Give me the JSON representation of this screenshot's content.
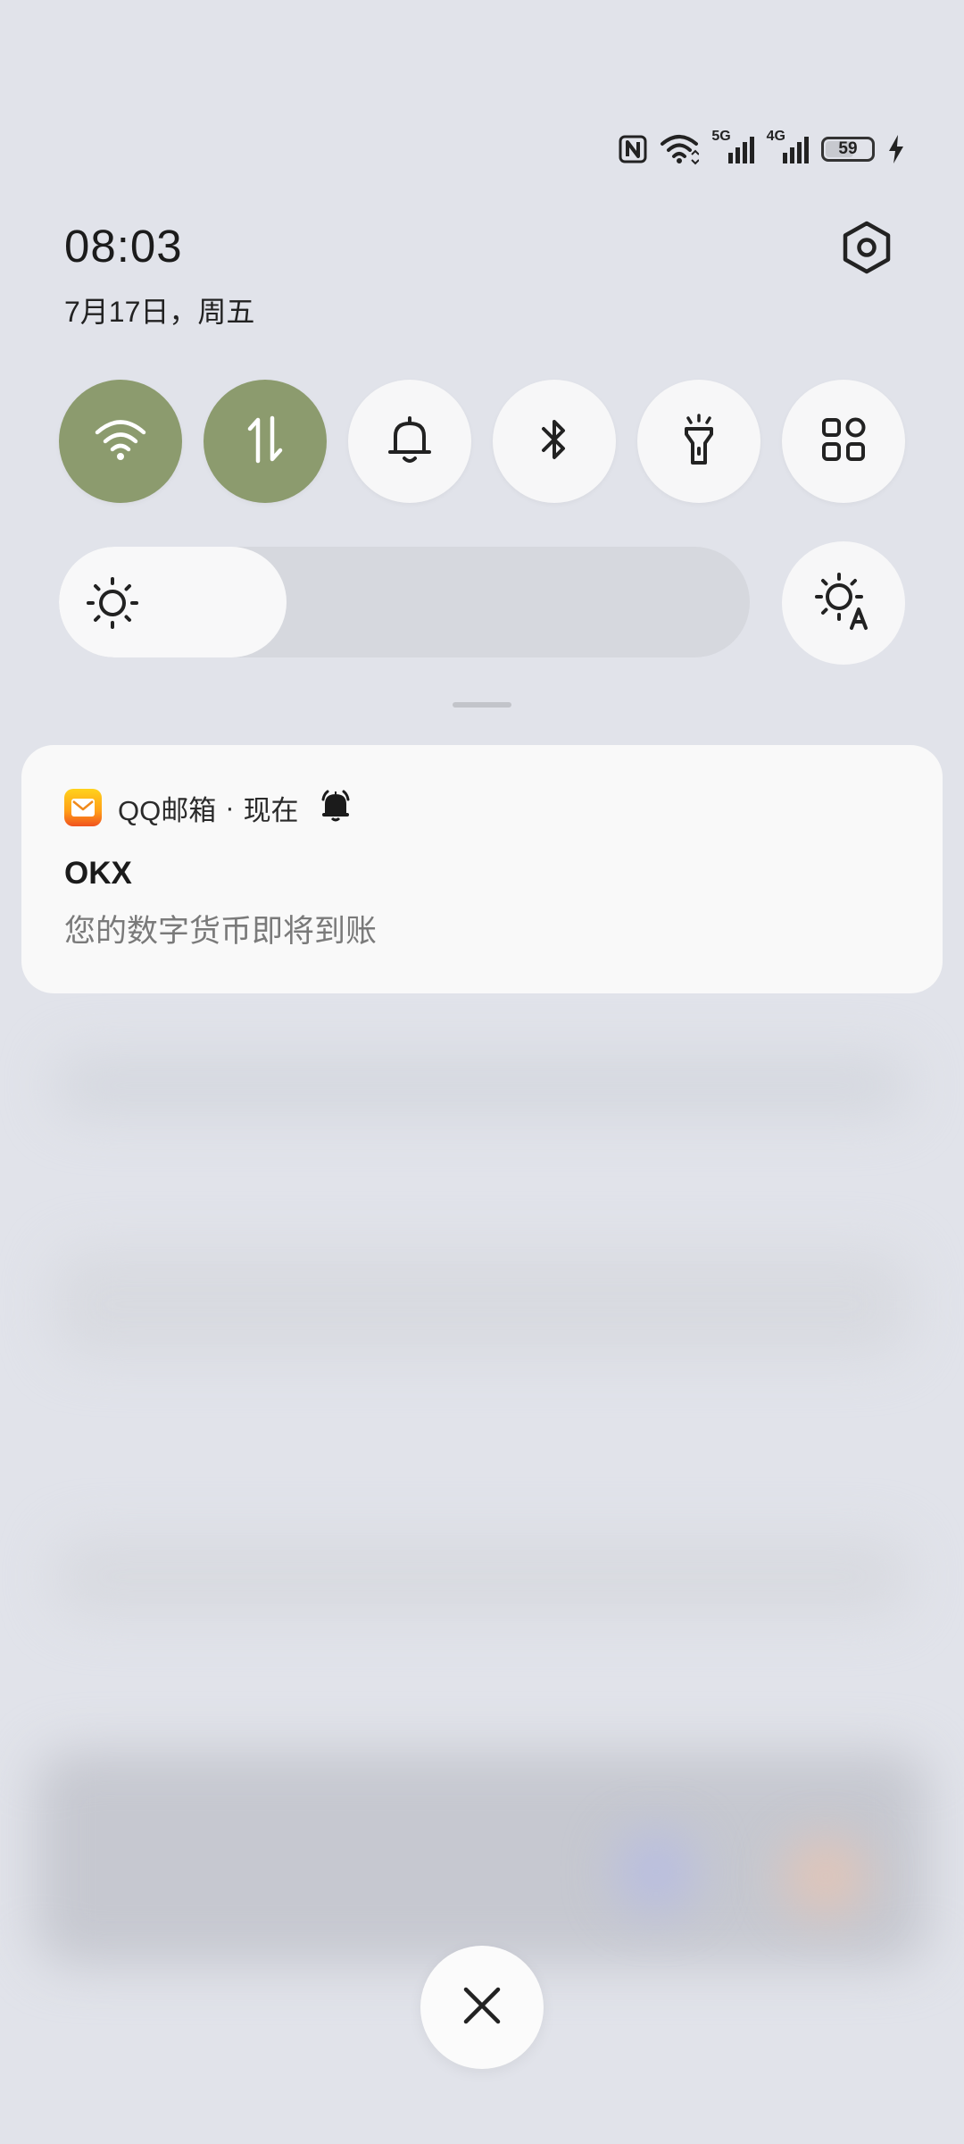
{
  "status_bar": {
    "net_5g": "5G",
    "net_4g": "4G",
    "battery_level": "59",
    "icons": [
      "nfc-icon",
      "wifi-icon",
      "signal-5g-icon",
      "signal-4g-icon",
      "battery-icon",
      "charging-icon"
    ]
  },
  "header": {
    "time": "08:03",
    "date": "7月17日，周五"
  },
  "quick_tiles": [
    {
      "name": "wifi",
      "active": true
    },
    {
      "name": "mobile-data",
      "active": true
    },
    {
      "name": "ring-mode",
      "active": false
    },
    {
      "name": "bluetooth",
      "active": false
    },
    {
      "name": "flashlight",
      "active": false
    },
    {
      "name": "more-tiles",
      "active": false
    }
  ],
  "brightness": {
    "level": 0.33
  },
  "notification": {
    "app_name": "QQ邮箱",
    "separator": "·",
    "time": "现在",
    "title": "OKX",
    "body": "您的数字货币即将到账"
  },
  "colors": {
    "active_tile": "#8c9b6e",
    "app_icon_top": "#ffd21c",
    "app_icon_bottom": "#f0521f"
  }
}
